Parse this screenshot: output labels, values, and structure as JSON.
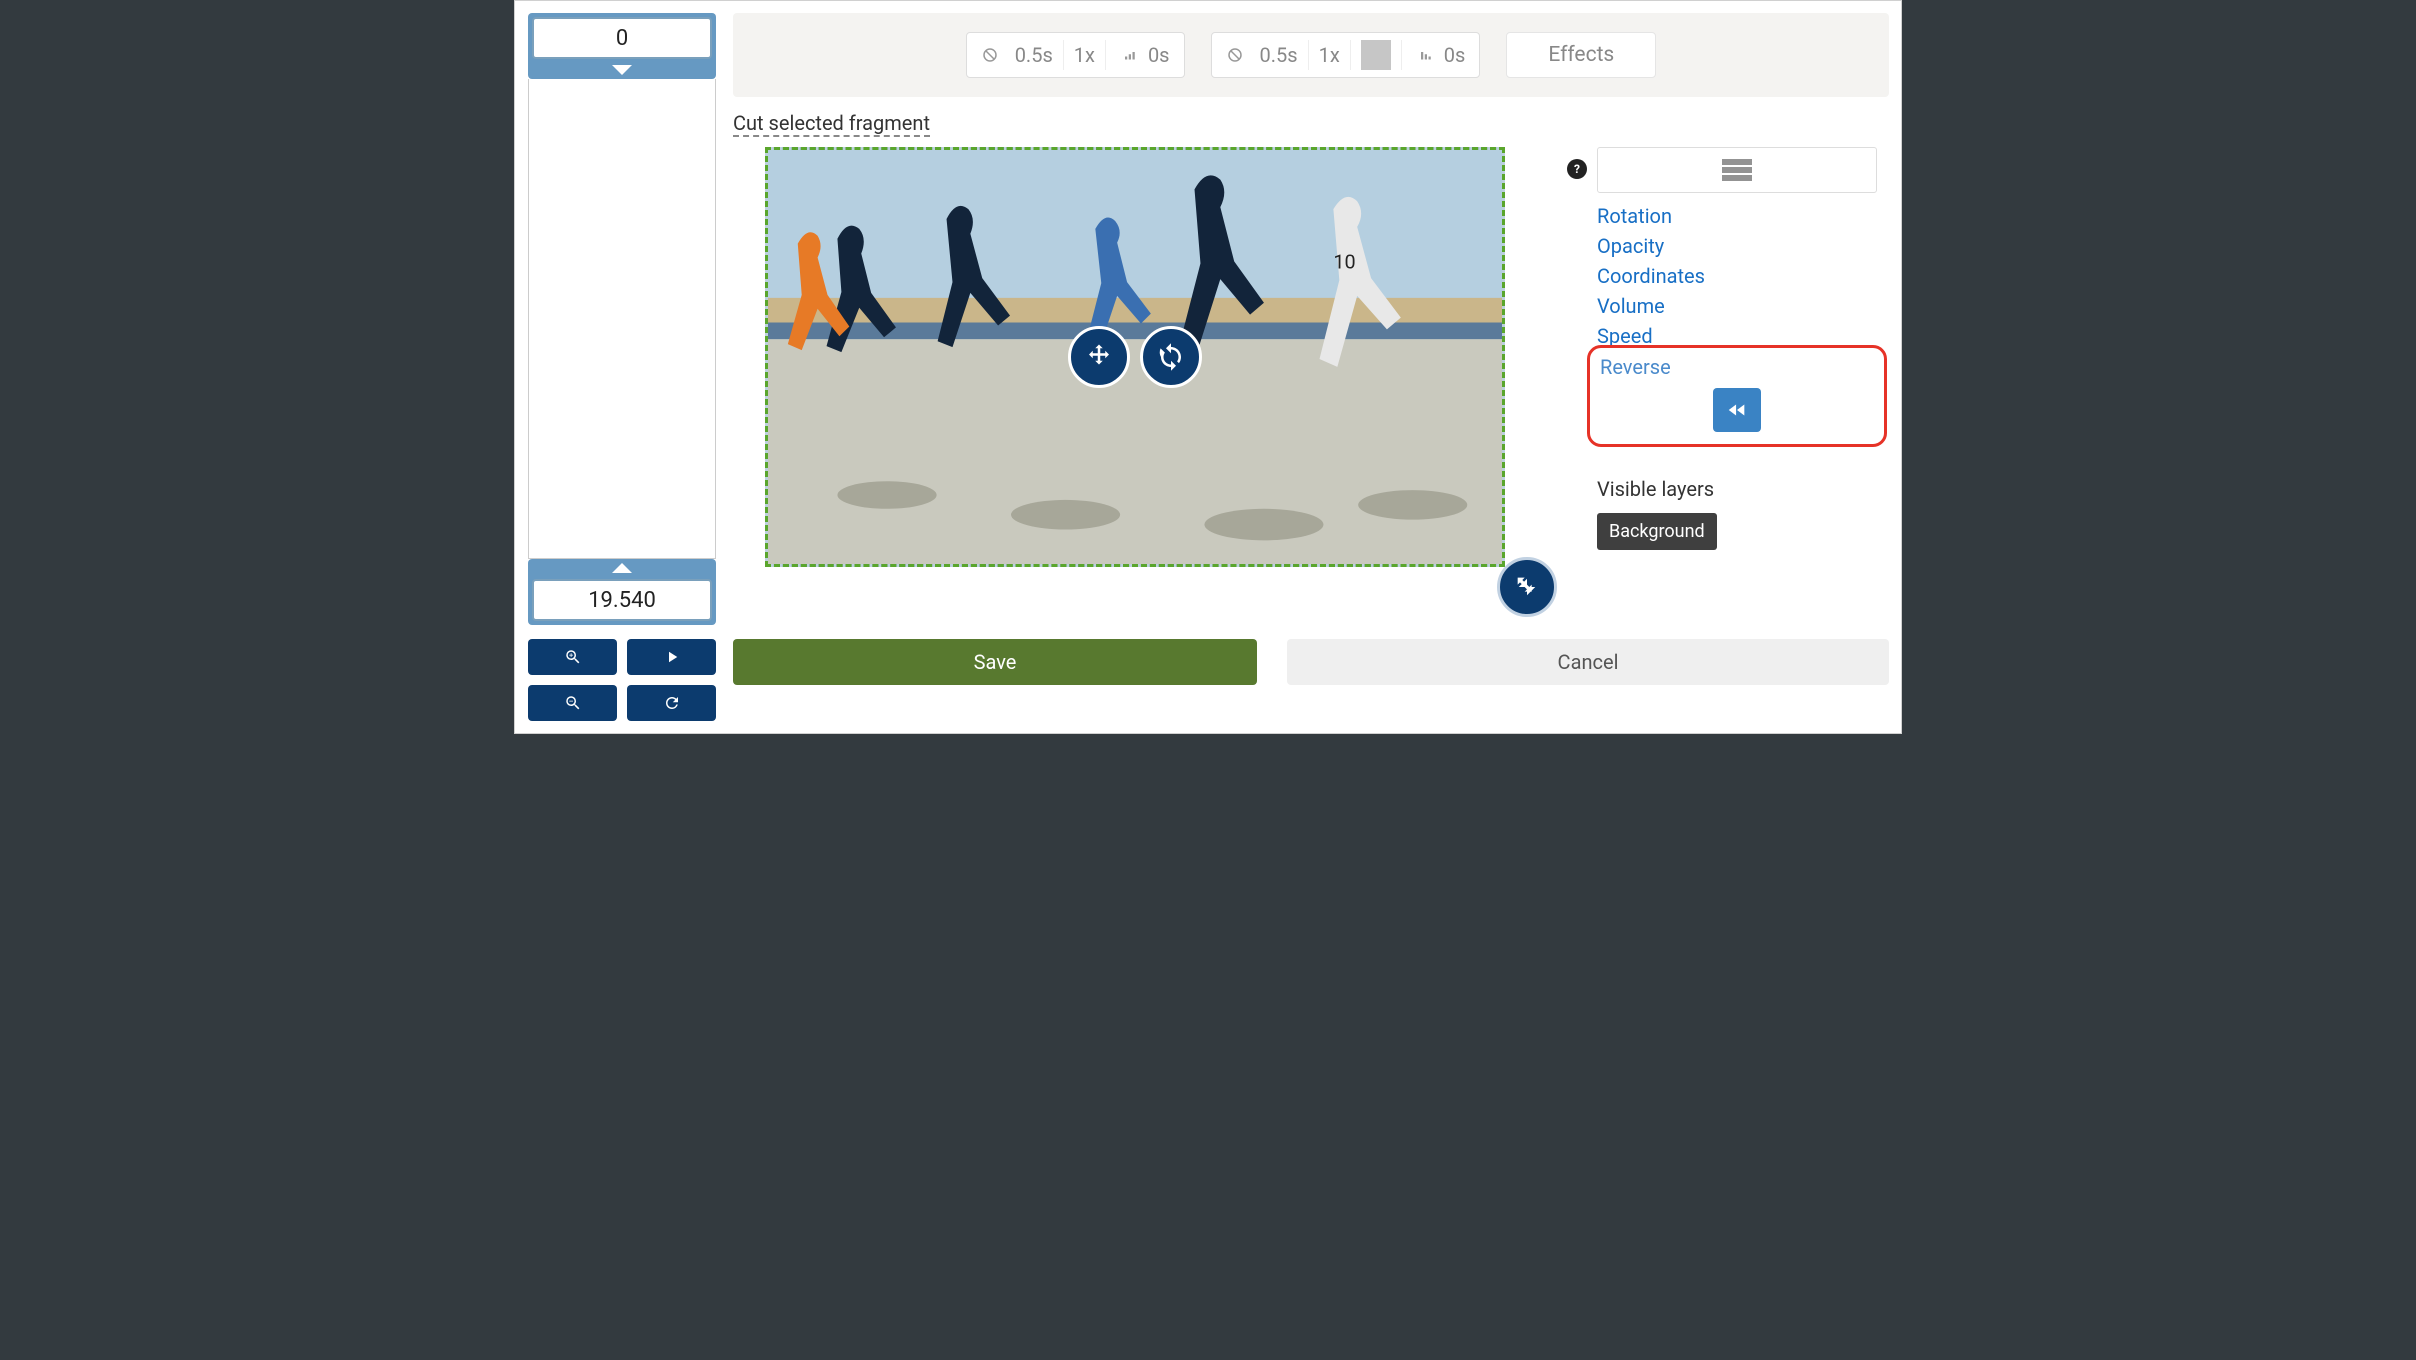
{
  "timeline": {
    "start_value": "0",
    "end_value": "19.540"
  },
  "toolbar": {
    "group_a": {
      "duration": "0.5s",
      "speed": "1x",
      "delay": "0s"
    },
    "group_b": {
      "duration": "0.5s",
      "speed": "1x",
      "delay": "0s"
    },
    "effects_label": "Effects"
  },
  "cut_link": "Cut selected fragment",
  "properties": {
    "items": [
      {
        "label": "Rotation"
      },
      {
        "label": "Opacity"
      },
      {
        "label": "Coordinates"
      },
      {
        "label": "Volume"
      },
      {
        "label": "Speed"
      }
    ],
    "reverse_label": "Reverse"
  },
  "visible_layers": {
    "title": "Visible layers",
    "background_label": "Background"
  },
  "actions": {
    "save_label": "Save",
    "cancel_label": "Cancel"
  },
  "help_badge": "?"
}
